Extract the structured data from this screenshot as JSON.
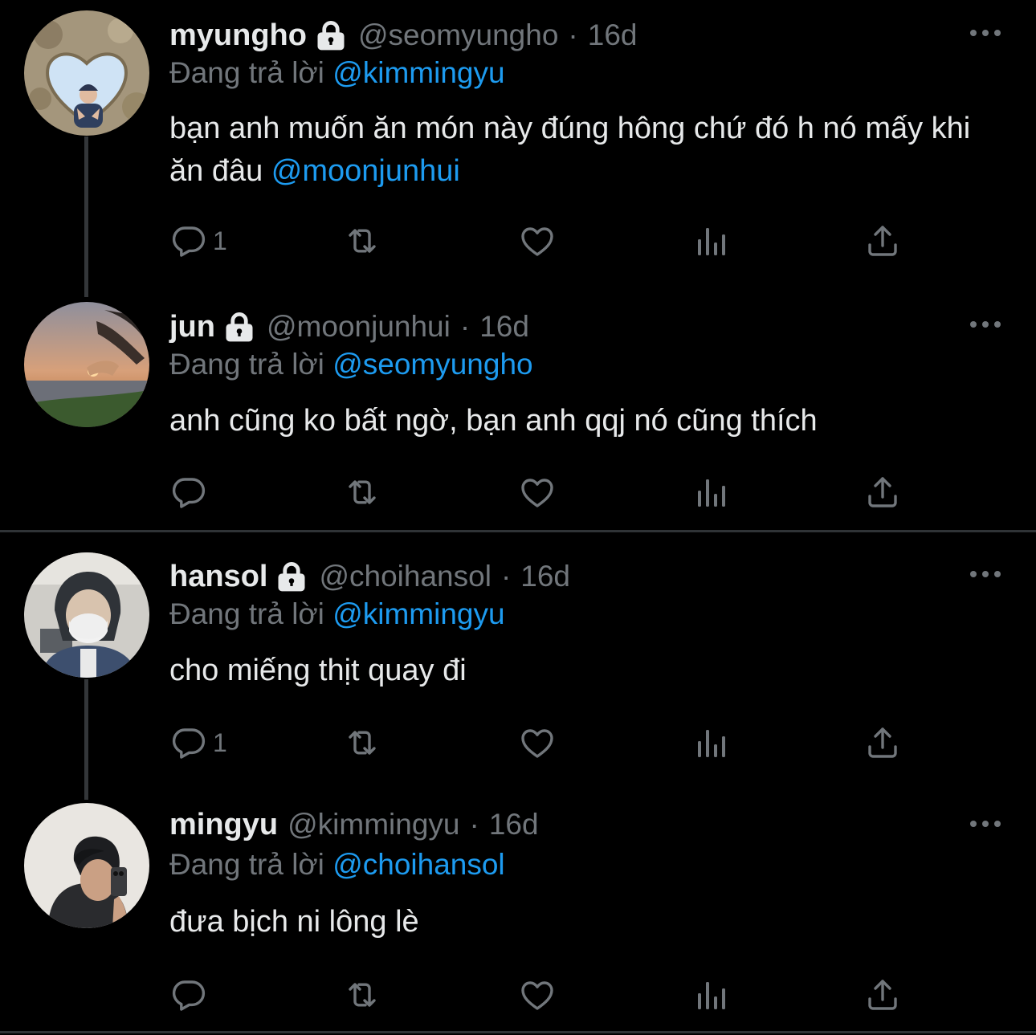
{
  "colors": {
    "background": "#000000",
    "text": "#e7e9ea",
    "muted": "#71767b",
    "accent": "#1d9bf0",
    "line": "#333639"
  },
  "tweets": [
    {
      "name": "myungho",
      "protected": true,
      "handle": "@seomyungho",
      "dot": "·",
      "time": "16d",
      "replying_prefix": "Đang trả lời",
      "replying_to": "@kimmingyu",
      "text": "bạn anh muốn ăn món này đúng hông chứ đó h nó mấy khi ăn đâu",
      "text_mention": "@moonjunhui",
      "reply_count": "1",
      "avatar": "avatar-heart-rock"
    },
    {
      "name": "jun",
      "protected": true,
      "handle": "@moonjunhui",
      "dot": "·",
      "time": "16d",
      "replying_prefix": "Đang trả lời",
      "replying_to": "@seomyungho",
      "text": "anh cũng ko bất ngờ, bạn anh qqj nó cũng thích",
      "reply_count": "",
      "avatar": "avatar-sunset"
    },
    {
      "name": "hansol",
      "protected": true,
      "handle": "@choihansol",
      "dot": "·",
      "time": "16d",
      "replying_prefix": "Đang trả lời",
      "replying_to": "@kimmingyu",
      "text": "cho miếng thịt quay đi",
      "reply_count": "1",
      "avatar": "avatar-masked"
    },
    {
      "name": "mingyu",
      "protected": false,
      "handle": "@kimmingyu",
      "dot": "·",
      "time": "16d",
      "replying_prefix": "Đang trả lời",
      "replying_to": "@choihansol",
      "text": "đưa bịch ni lông lè",
      "reply_count": "",
      "avatar": "avatar-mirror-selfie"
    }
  ],
  "icons": {
    "reply": "reply-icon",
    "retweet": "retweet-icon",
    "like": "heart-icon",
    "views": "views-icon",
    "share": "share-icon",
    "more": "more-icon",
    "lock": "lock-icon"
  }
}
